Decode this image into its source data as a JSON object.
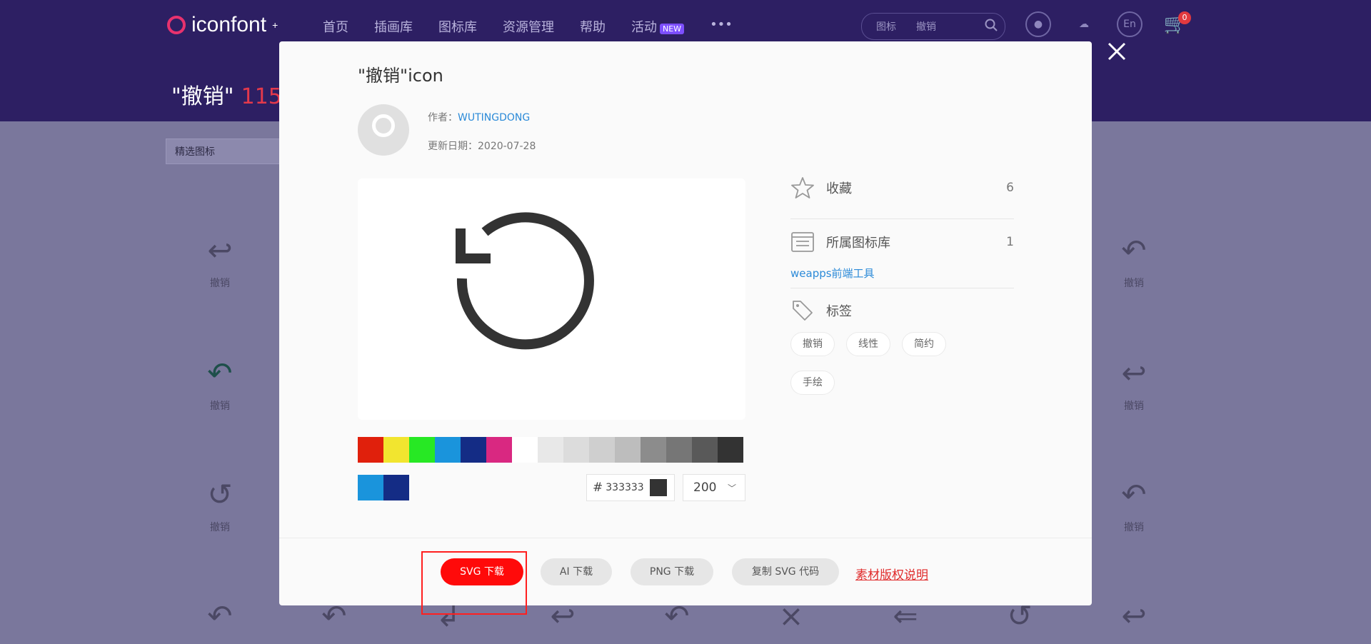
{
  "site": {
    "logo": "iconfont",
    "logo_mark": "+",
    "nav": [
      "首页",
      "插画库",
      "图标库",
      "资源管理",
      "帮助",
      "活动"
    ],
    "nav_badge": "NEW",
    "nav_more": "•••",
    "search": {
      "scope": "图标",
      "value": "撤销"
    },
    "lang_icon_text": "En",
    "cart_count": "0",
    "page_title": "\"撤销\"",
    "result_count": "115",
    "filter_label": "精选图标",
    "icon_label": "撤销"
  },
  "modal": {
    "title": "\"撤销\"icon",
    "author_label": "作者：",
    "author": "WUTINGDONG",
    "date_label": "更新日期：",
    "date": "2020-07-28",
    "icon_color": "#333333",
    "color_value": "333333",
    "hash": "#",
    "size_value": "200",
    "palette": [
      "#e0200c",
      "#f2e52f",
      "#27e824",
      "#1a94dc",
      "#142c85",
      "#d92881",
      "#ffffff",
      "#e8e8e8",
      "#dcdcdc",
      "#cfcfcf",
      "#bdbdbd",
      "#8c8c8c",
      "#767676",
      "#595959",
      "#333333"
    ],
    "palette_recent": [
      "#1a94dc",
      "#142c85"
    ],
    "favorites_label": "收藏",
    "favorites_count": "6",
    "library_label": "所属图标库",
    "library_count": "1",
    "library_name": "weapps前端工具",
    "tags_label": "标签",
    "tags": [
      "撤销",
      "线性",
      "简约",
      "手绘"
    ],
    "buttons": {
      "svg": "SVG 下载",
      "ai": "AI 下载",
      "png": "PNG 下载",
      "copy": "复制 SVG 代码"
    },
    "license": "素材版权说明"
  }
}
